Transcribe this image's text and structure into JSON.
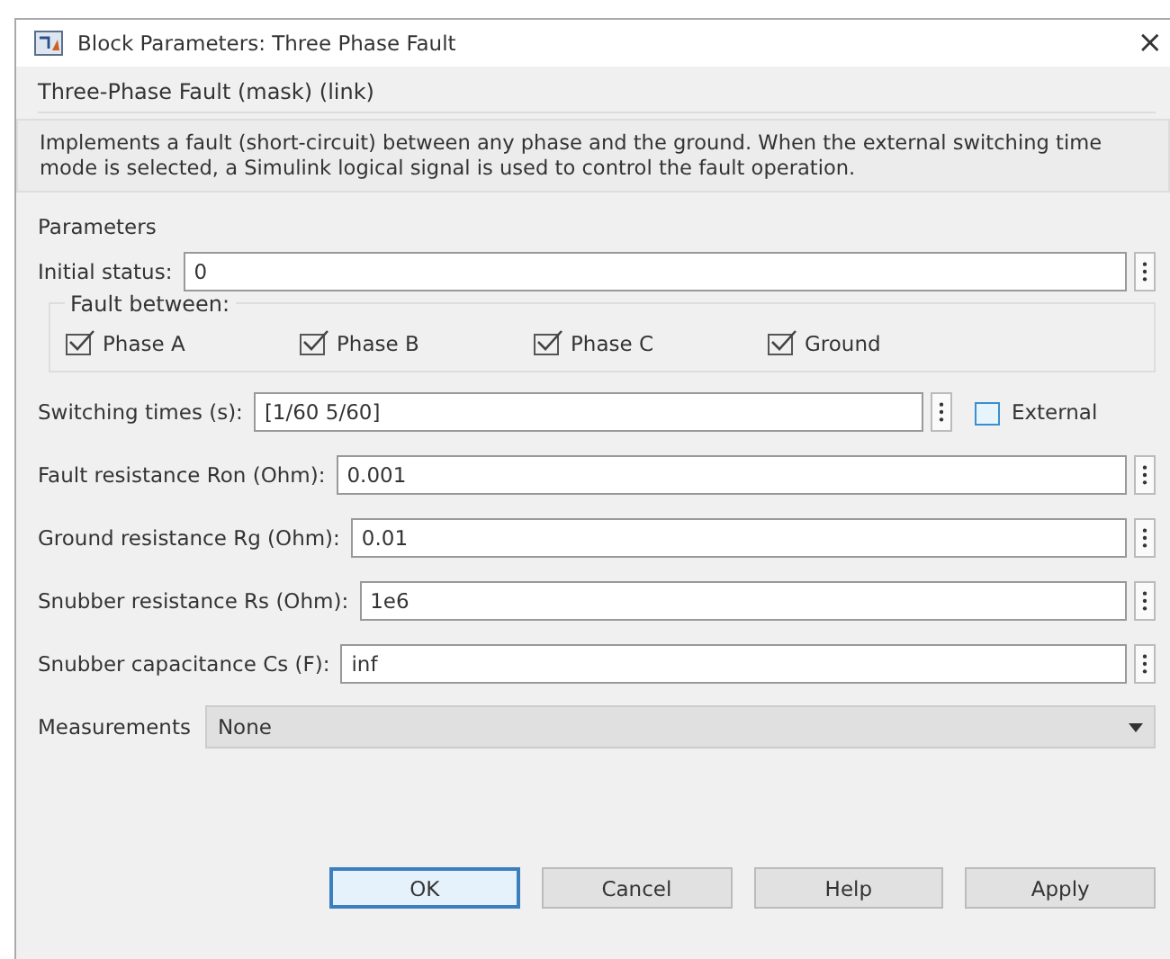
{
  "window": {
    "title": "Block Parameters: Three Phase Fault",
    "close": "×"
  },
  "header": "Three-Phase Fault (mask) (link)",
  "description": "Implements a fault (short-circuit) between any phase and the ground. When the external switching time mode is selected, a Simulink logical signal is used to control the fault operation.",
  "parameters_label": "Parameters",
  "initial_status": {
    "label": "Initial status:",
    "value": "0"
  },
  "fault_between": {
    "title": "Fault between:",
    "options": [
      {
        "label": "Phase A",
        "checked": true
      },
      {
        "label": "Phase B",
        "checked": true
      },
      {
        "label": "Phase C",
        "checked": true
      },
      {
        "label": "Ground",
        "checked": true
      }
    ]
  },
  "switching_times": {
    "label": "Switching times (s):",
    "value": "[1/60  5/60]",
    "external": {
      "label": "External",
      "checked": false
    }
  },
  "fields": [
    {
      "label": "Fault resistance Ron (Ohm):",
      "value": "0.001"
    },
    {
      "label": "Ground resistance Rg (Ohm):",
      "value": "0.01"
    },
    {
      "label": "Snubber resistance Rs (Ohm):",
      "value": "1e6"
    },
    {
      "label": "Snubber capacitance Cs (F):",
      "value": "inf"
    }
  ],
  "measurements": {
    "label": "Measurements",
    "value": "None"
  },
  "buttons": [
    {
      "label": "OK",
      "focused": true
    },
    {
      "label": "Cancel",
      "focused": false
    },
    {
      "label": "Help",
      "focused": false
    },
    {
      "label": "Apply",
      "focused": false
    }
  ]
}
